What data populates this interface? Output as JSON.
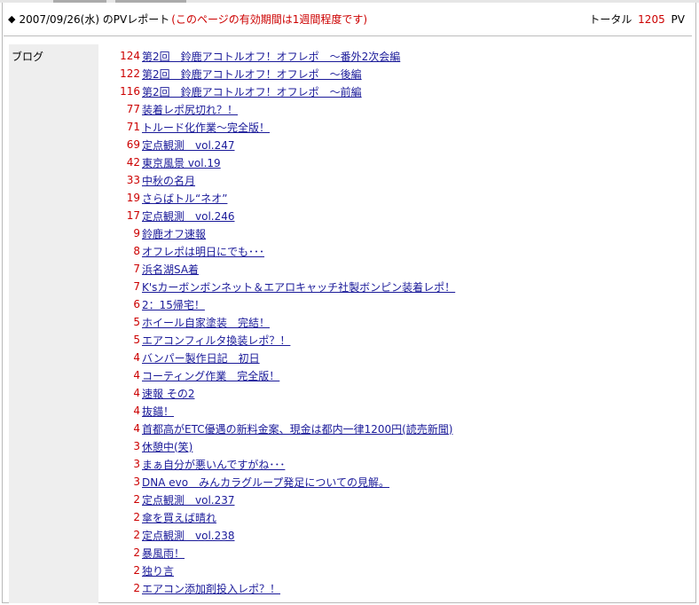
{
  "header": {
    "date_title": "2007/09/26(水) のPVレポート",
    "notice": "(このページの有効期間は1週間程度です)",
    "total_label": "トータル",
    "total_value": "1205",
    "total_unit": "PV"
  },
  "category": "ブログ",
  "entries": [
    {
      "count": "124",
      "title": "第2回　鈴鹿アコトルオフ！オフレポ　～番外2次会編"
    },
    {
      "count": "122",
      "title": "第2回　鈴鹿アコトルオフ！オフレポ　～後編"
    },
    {
      "count": "116",
      "title": "第2回　鈴鹿アコトルオフ！オフレポ　～前編"
    },
    {
      "count": "77",
      "title": "装着レポ尻切れ？！"
    },
    {
      "count": "71",
      "title": "トルード化作業～完全版！"
    },
    {
      "count": "69",
      "title": "定点観測　vol.247"
    },
    {
      "count": "42",
      "title": "東京風景 vol.19"
    },
    {
      "count": "33",
      "title": "中秋の名月"
    },
    {
      "count": "19",
      "title": "さらばトル“ネオ”"
    },
    {
      "count": "17",
      "title": "定点観測　vol.246"
    },
    {
      "count": "9",
      "title": "鈴鹿オフ速報"
    },
    {
      "count": "8",
      "title": "オフレポは明日にでも･･･"
    },
    {
      "count": "7",
      "title": "浜名湖SA着"
    },
    {
      "count": "7",
      "title": "K'sカーボンボンネット＆エアロキャッチ社製ボンピン装着レポ！"
    },
    {
      "count": "6",
      "title": "2：15帰宅！"
    },
    {
      "count": "5",
      "title": "ホイール自家塗装　完結！"
    },
    {
      "count": "5",
      "title": "エアコンフィルタ換装レポ？！"
    },
    {
      "count": "4",
      "title": "バンパー製作日記　初日"
    },
    {
      "count": "4",
      "title": "コーティング作業　完全版！"
    },
    {
      "count": "4",
      "title": "速報 その2"
    },
    {
      "count": "4",
      "title": "抜錨！"
    },
    {
      "count": "4",
      "title": "首都高がETC優遇の新料金案、現金は都内一律1200円(読売新聞)"
    },
    {
      "count": "3",
      "title": "休憩中(笑)"
    },
    {
      "count": "3",
      "title": "まぁ自分が悪いんですがね･･･"
    },
    {
      "count": "3",
      "title": "DNA evo　みんカラグループ発足についての見解。"
    },
    {
      "count": "2",
      "title": "定点観測　vol.237"
    },
    {
      "count": "2",
      "title": "傘を買えば晴れ"
    },
    {
      "count": "2",
      "title": "定点観測　vol.238"
    },
    {
      "count": "2",
      "title": "暴風雨！"
    },
    {
      "count": "2",
      "title": "独り言"
    },
    {
      "count": "2",
      "title": "エアコン添加剤投入レポ？！"
    }
  ],
  "colors": {
    "count": "#cc0000",
    "link": "#1a1a99",
    "notice": "#cc0000",
    "category_bg": "#eeeeee"
  }
}
